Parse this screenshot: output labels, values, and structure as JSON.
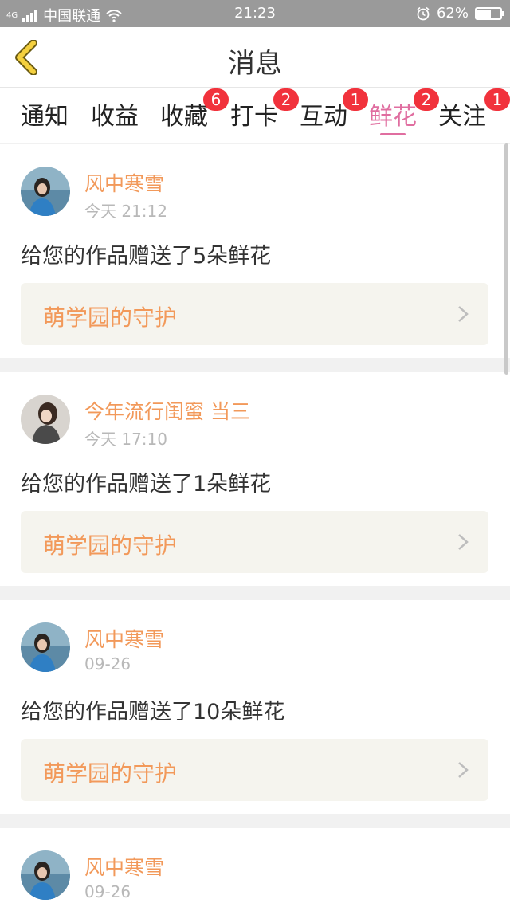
{
  "status_bar": {
    "network": "4G",
    "carrier": "中国联通",
    "time": "21:23",
    "battery": "62%",
    "battery_level": 0.62
  },
  "header": {
    "title": "消息",
    "back_icon": "chevron-left-icon"
  },
  "tabs": [
    {
      "label": "通知",
      "badge": ""
    },
    {
      "label": "收益",
      "badge": ""
    },
    {
      "label": "收藏",
      "badge": "6"
    },
    {
      "label": "打卡",
      "badge": "2"
    },
    {
      "label": "互动",
      "badge": "1"
    },
    {
      "label": "鲜花",
      "badge": "2",
      "active": true
    },
    {
      "label": "关注",
      "badge": "1"
    }
  ],
  "messages": [
    {
      "name": "风中寒雪",
      "time": "今天 21:12",
      "text": "给您的作品赠送了5朵鲜花",
      "link": "萌学园的守护"
    },
    {
      "name": "今年流行闺蜜 当三",
      "time": "今天 17:10",
      "text": "给您的作品赠送了1朵鲜花",
      "link": "萌学园的守护"
    },
    {
      "name": "风中寒雪",
      "time": "09-26",
      "text": "给您的作品赠送了10朵鲜花",
      "link": "萌学园的守护"
    },
    {
      "name": "风中寒雪",
      "time": "09-26",
      "text": "",
      "link": ""
    }
  ],
  "colors": {
    "accent_pink": "#e06ea0",
    "name_orange": "#f2995a",
    "badge_red": "#f1323c",
    "back_yellow": "#f4d03f"
  }
}
